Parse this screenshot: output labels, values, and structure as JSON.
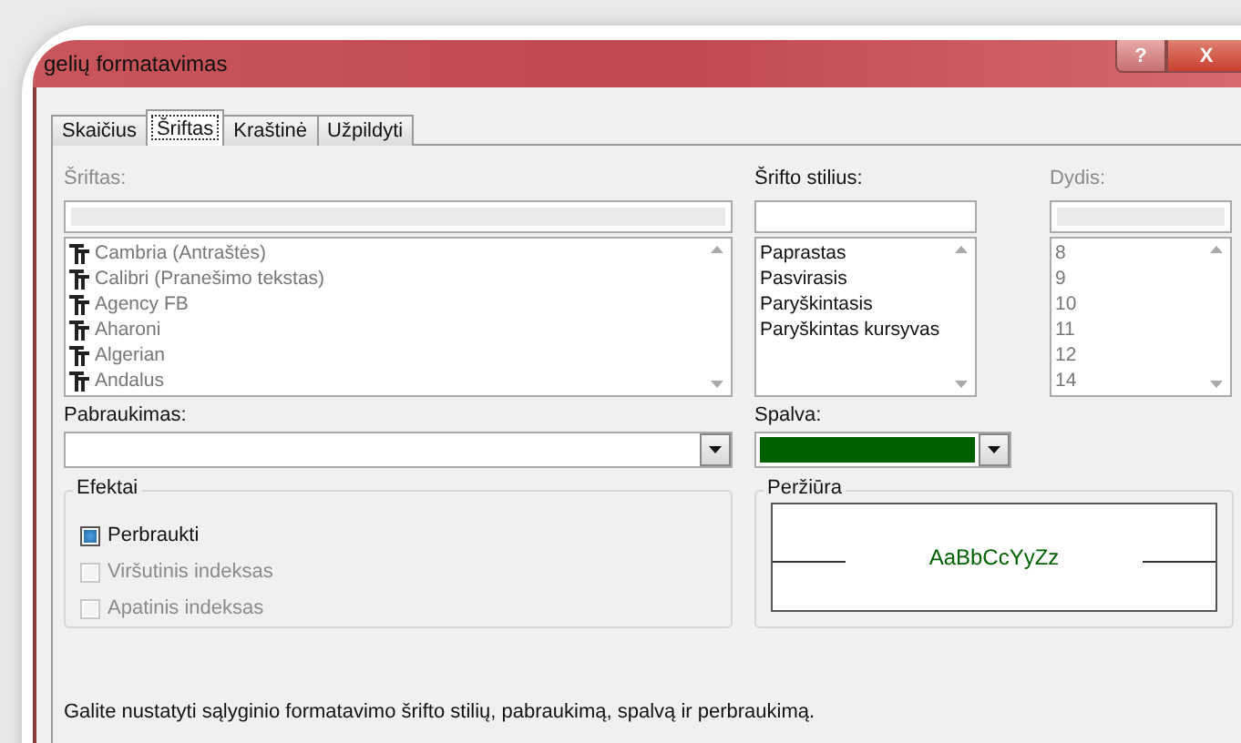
{
  "window": {
    "title": "gelių formatavimas"
  },
  "title_buttons": [
    {
      "kind": "help",
      "label": "?"
    },
    {
      "kind": "close",
      "label": "X"
    }
  ],
  "tabs": [
    {
      "label": "Skaičius",
      "selected": false
    },
    {
      "label": "Šriftas",
      "selected": true
    },
    {
      "label": "Kraštinė",
      "selected": false
    },
    {
      "label": "Užpildyti",
      "selected": false
    }
  ],
  "font": {
    "label": "Šriftas:",
    "disabled": true,
    "items": [
      "Cambria (Antraštės)",
      "Calibri (Pranešimo tekstas)",
      "Agency FB",
      "Aharoni",
      "Algerian",
      "Andalus"
    ]
  },
  "font_style": {
    "label": "Šrifto stilius:",
    "disabled": false,
    "items": [
      "Paprastas",
      "Pasvirasis",
      "Paryškintasis",
      "Paryškintas kursyvas"
    ]
  },
  "size": {
    "label": "Dydis:",
    "disabled": true,
    "items": [
      "8",
      "9",
      "10",
      "11",
      "12",
      "14"
    ]
  },
  "underline": {
    "label": "Pabraukimas:"
  },
  "color": {
    "label": "Spalva:",
    "color": "#006100"
  },
  "effects": {
    "title": "Efektai",
    "items": [
      {
        "label": "Perbraukti",
        "checked": true,
        "disabled": false
      },
      {
        "label": "Viršutinis indeksas",
        "checked": false,
        "disabled": true
      },
      {
        "label": "Apatinis indeksas",
        "checked": false,
        "disabled": true
      }
    ]
  },
  "preview": {
    "title": "Peržiūra",
    "sample": "AaBbCcYyZz"
  },
  "hint": "Galite nustatyti sąlyginio formatavimo šrifto stilių, pabraukimą, spalvą ir perbraukimą."
}
